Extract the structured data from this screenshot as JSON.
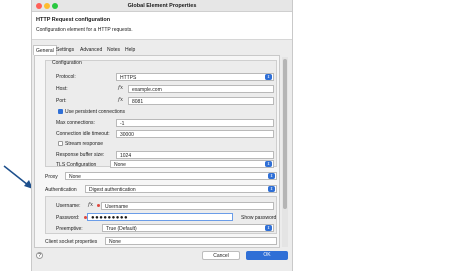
{
  "window": {
    "title": "Global Element Properties"
  },
  "header": {
    "title": "HTTP Request configuration",
    "description": "Configuration element for a HTTP requests."
  },
  "tabs": [
    {
      "label": "General",
      "active": true
    },
    {
      "label": "Settings"
    },
    {
      "label": "Advanced"
    },
    {
      "label": "Notes"
    },
    {
      "label": "Help"
    }
  ],
  "configuration": {
    "group_title": "Configuration",
    "protocol": {
      "label": "Protocol:",
      "value": "HTTPS"
    },
    "host": {
      "label": "Host:",
      "value": "example.com"
    },
    "port": {
      "label": "Port:",
      "value": "8081"
    },
    "persistent": {
      "label": "Use persistent connections",
      "checked": true
    },
    "max_connections": {
      "label": "Max connections:",
      "value": "-1"
    },
    "idle_timeout": {
      "label": "Connection idle timeout:",
      "value": "30000"
    },
    "stream_response": {
      "label": "Stream response",
      "checked": false
    },
    "buffer_size": {
      "label": "Response buffer size:",
      "value": "1024"
    },
    "tls": {
      "label": "TLS Configuration",
      "value": "None"
    }
  },
  "proxy": {
    "label": "Proxy",
    "value": "None"
  },
  "authentication": {
    "label": "Authentication",
    "value": "Digest authentication",
    "username": {
      "label": "Username:",
      "value": "Username"
    },
    "password": {
      "label": "Password:",
      "value": "●●●●●●●●●",
      "show_label": "Show password"
    },
    "preemptive": {
      "label": "Preemptive:",
      "value": "True (Default)"
    }
  },
  "client_socket": {
    "label": "Client socket properties",
    "value": "None"
  },
  "buttons": {
    "cancel": "Cancel",
    "ok": "OK"
  },
  "icons": {
    "expression": "fx",
    "select": "chevron-updown-icon"
  },
  "colors": {
    "accent": "#2f6fd6",
    "annotation_arrow": "#1d4f8c"
  }
}
